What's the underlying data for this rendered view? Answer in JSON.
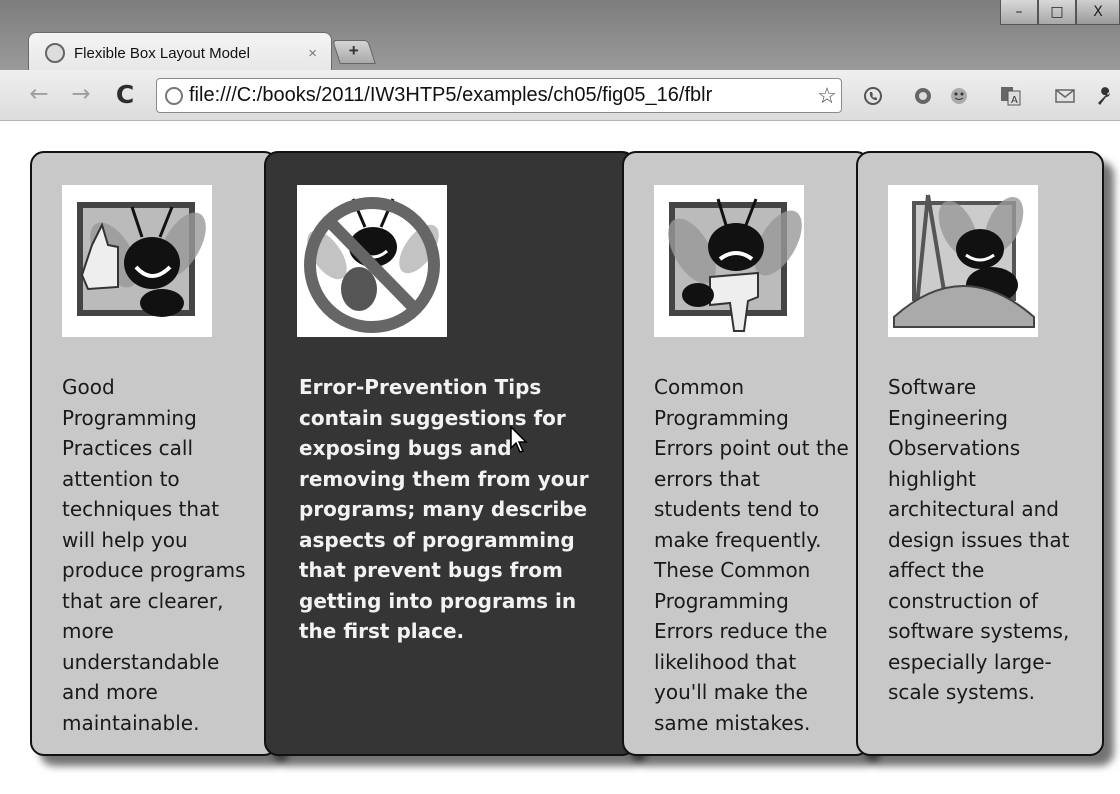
{
  "window": {
    "controls": {
      "minimize": "–",
      "maximize": "□",
      "close": "X"
    }
  },
  "tab": {
    "title": "Flexible Box Layout Model",
    "close_label": "×",
    "new_tab_label": "+"
  },
  "toolbar": {
    "back_label": "←",
    "forward_label": "→",
    "reload_label": "C",
    "url": "file:///C:/books/2011/IW3HTP5/examples/ch05/fig05_16/fblr",
    "star_label": "☆"
  },
  "extensions": [
    "phone-icon",
    "refresh-circle-icon",
    "face-icon",
    "translate-icon",
    "mail-icon",
    "wrench-icon"
  ],
  "boxes": [
    {
      "icon": "good-practice-thumbs-up-bug-icon",
      "text": "Good Programming Practices call attention to techniques that will help you produce programs that are clearer, more understandable and more maintainable."
    },
    {
      "icon": "error-prevention-no-bug-icon",
      "text": "Error-Prevention Tips contain suggestions for exposing bugs and removing them from your programs; many describe aspects of programming that prevent bugs from getting into programs in the first place."
    },
    {
      "icon": "common-error-thumbs-down-bug-icon",
      "text": "Common Programming Errors point out the errors that students tend to make frequently. These Common Programming Errors reduce the likelihood that you'll make the same mistakes."
    },
    {
      "icon": "software-engineering-compass-bug-icon",
      "text": "Software Engineering Observations highlight architectural and design issues that affect the construction of software systems, especially large-scale systems."
    }
  ],
  "colors": {
    "box_background": "#c8c8c8",
    "active_box_background": "#353535",
    "box_border": "#111111"
  }
}
